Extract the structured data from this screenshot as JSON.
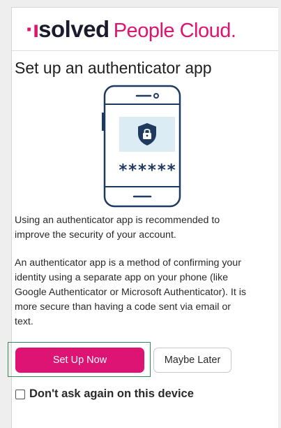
{
  "brand": {
    "logo_mark": "·ı",
    "logo_text": "solved",
    "product": "People Cloud."
  },
  "page": {
    "title": "Set up an authenticator app"
  },
  "illustration": {
    "masked_code": "******",
    "icon": "lock-shield-icon"
  },
  "body": {
    "paragraph1": "Using an authenticator app is recommended to improve the security of your account.",
    "paragraph2": "An authenticator app is a method of confirming your identity using a separate app on your phone (like Google Authenticator or Microsoft Authenticator). It is more secure than having a code sent via email or text."
  },
  "actions": {
    "setup_label": "Set Up Now",
    "later_label": "Maybe Later"
  },
  "dont_ask": {
    "label": "Don't ask again on this device",
    "checked": false
  },
  "colors": {
    "brand_magenta": "#dd1474",
    "brand_navy": "#1b1b2f",
    "illustration_navy": "#1e3a5f",
    "illustration_panel": "#dcecf4",
    "focus_outline": "#2e8b57"
  }
}
